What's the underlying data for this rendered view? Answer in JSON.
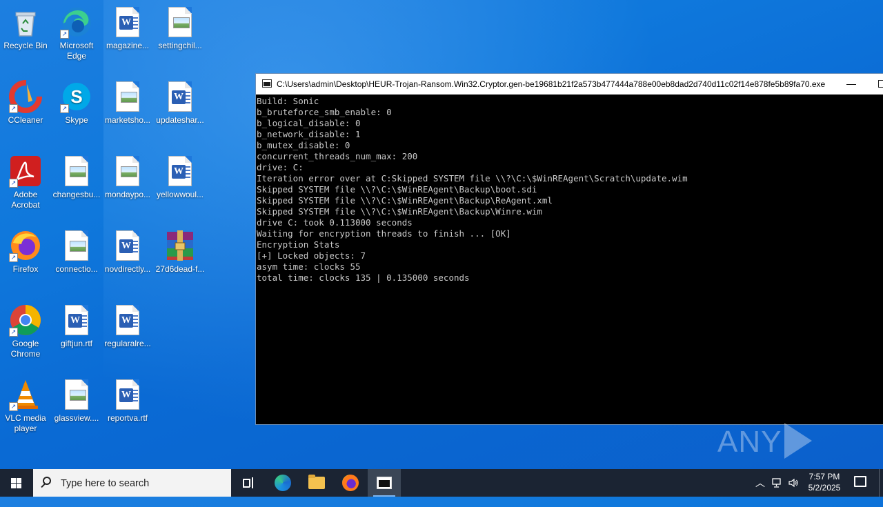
{
  "desktop": {
    "icons": [
      {
        "label": "Recycle Bin",
        "icon": "recycle-bin-icon"
      },
      {
        "label": "Microsoft Edge",
        "icon": "edge-icon"
      },
      {
        "label": "magazine...",
        "icon": "word-doc-icon"
      },
      {
        "label": "settingchil...",
        "icon": "image-doc-icon"
      },
      {
        "label": "CCleaner",
        "icon": "ccleaner-icon"
      },
      {
        "label": "Skype",
        "icon": "skype-icon"
      },
      {
        "label": "marketsho...",
        "icon": "image-doc-icon"
      },
      {
        "label": "updateshar...",
        "icon": "word-doc-icon"
      },
      {
        "label": "Adobe Acrobat",
        "icon": "acrobat-icon"
      },
      {
        "label": "changesbu...",
        "icon": "image-doc-icon"
      },
      {
        "label": "mondaypo...",
        "icon": "image-doc-icon"
      },
      {
        "label": "yellowwoul...",
        "icon": "word-doc-icon"
      },
      {
        "label": "Firefox",
        "icon": "firefox-icon"
      },
      {
        "label": "connectio...",
        "icon": "image-doc-icon"
      },
      {
        "label": "novdirectly...",
        "icon": "word-doc-icon"
      },
      {
        "label": "27d6dead-f...",
        "icon": "winrar-icon"
      },
      {
        "label": "Google Chrome",
        "icon": "chrome-icon"
      },
      {
        "label": "giftjun.rtf",
        "icon": "word-doc-icon"
      },
      {
        "label": "regularalre...",
        "icon": "word-doc-icon"
      },
      {
        "label": "VLC media player",
        "icon": "vlc-icon"
      },
      {
        "label": "glassview....",
        "icon": "image-doc-icon"
      },
      {
        "label": "reportva.rtf",
        "icon": "word-doc-icon"
      }
    ]
  },
  "console": {
    "title": "C:\\Users\\admin\\Desktop\\HEUR-Trojan-Ransom.Win32.Cryptor.gen-be19681b21f2a573b477444a788e00eb8dad2d740d11c02f14e878fe5b89fa70.exe",
    "lines": [
      "Build: Sonic",
      "b_bruteforce_smb_enable: 0",
      "b_logical_disable: 0",
      "b_network_disable: 1",
      "b_mutex_disable: 0",
      "concurrent_threads_num_max: 200",
      "drive: C:",
      "Iteration error over at C:Skipped SYSTEM file \\\\?\\C:\\$WinREAgent\\Scratch\\update.wim",
      "Skipped SYSTEM file \\\\?\\C:\\$WinREAgent\\Backup\\boot.sdi",
      "Skipped SYSTEM file \\\\?\\C:\\$WinREAgent\\Backup\\ReAgent.xml",
      "Skipped SYSTEM file \\\\?\\C:\\$WinREAgent\\Backup\\Winre.wim",
      "drive C: took 0.113000 seconds",
      "Waiting for encryption threads to finish ... [OK]",
      "Encryption Stats",
      "[+] Locked objects: 7",
      "asym time: clocks 55",
      "total time: clocks 135 | 0.135000 seconds"
    ]
  },
  "watermark": {
    "left": "ANY",
    "right": "RUN"
  },
  "taskbar": {
    "search_placeholder": "Type here to search",
    "apps": [
      {
        "name": "Task View",
        "icon": "task-view-icon"
      },
      {
        "name": "Microsoft Edge",
        "icon": "edge-icon"
      },
      {
        "name": "File Explorer",
        "icon": "folder-icon"
      },
      {
        "name": "Firefox",
        "icon": "firefox-icon"
      },
      {
        "name": "Console",
        "icon": "console-icon",
        "active": true
      }
    ],
    "clock_time": "7:57 PM",
    "clock_date": "5/2/2025"
  }
}
